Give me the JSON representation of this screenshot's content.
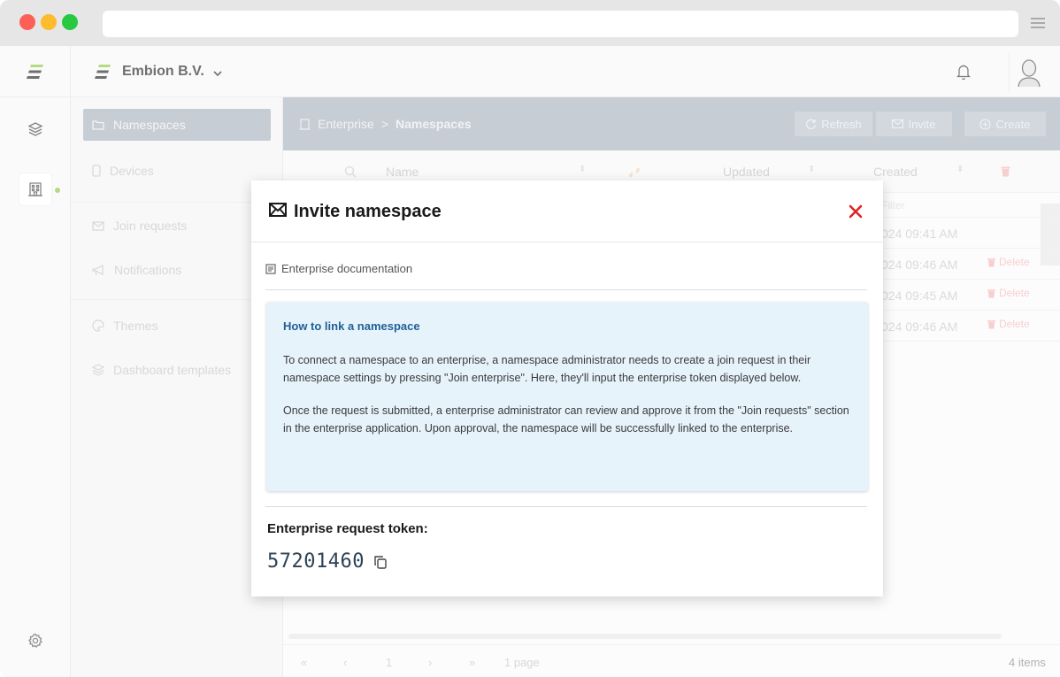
{
  "app": {
    "organization": "Embion B.V."
  },
  "side_menu": {
    "items": [
      {
        "label": "Namespaces",
        "icon": "folder-icon",
        "active": true
      },
      {
        "label": "Devices",
        "icon": "device-icon"
      },
      {
        "label": "Join requests",
        "icon": "envelope-icon"
      },
      {
        "label": "Notifications",
        "icon": "megaphone-icon"
      },
      {
        "label": "Themes",
        "icon": "palette-icon"
      },
      {
        "label": "Dashboard templates",
        "icon": "layers-icon"
      }
    ]
  },
  "breadcrumb": {
    "root": "Enterprise",
    "separator": ">",
    "current": "Namespaces"
  },
  "toolbar": {
    "refresh": "Refresh",
    "invite": "Invite",
    "create": "Create"
  },
  "table": {
    "columns": [
      "Name",
      "Updated",
      "Created"
    ],
    "filter_placeholder": "Filter",
    "rows": [
      {
        "created": "024 09:41 AM",
        "action": ""
      },
      {
        "created": "024 09:46 AM",
        "action": "Delete"
      },
      {
        "created": "024 09:45 AM",
        "action": "Delete"
      },
      {
        "created": "024 09:46 AM",
        "action": "Delete"
      }
    ]
  },
  "pager": {
    "first": "«",
    "prev": "‹",
    "page": "1",
    "next": "›",
    "last": "»",
    "pages_text": "1 page",
    "items_text": "4 items"
  },
  "modal": {
    "title": "Invite namespace",
    "doc_link": "Enterprise documentation",
    "info_title": "How to link a namespace",
    "info_p1": "To connect a namespace to an enterprise, a namespace administrator needs to create a join request in their namespace settings by pressing \"Join enterprise\". Here, they'll input the enterprise token displayed below.",
    "info_p2": "Once the request is submitted, a enterprise administrator can review and approve it from the \"Join requests\" section in the enterprise application. Upon approval, the namespace will be successfully linked to the enterprise.",
    "token_label": "Enterprise request token:",
    "token_value": "57201460"
  },
  "colors": {
    "accent_blue": "#1f5f96",
    "close_red": "#e02424",
    "info_bg": "#e7f3fb",
    "brand_green": "#8cc63f"
  }
}
